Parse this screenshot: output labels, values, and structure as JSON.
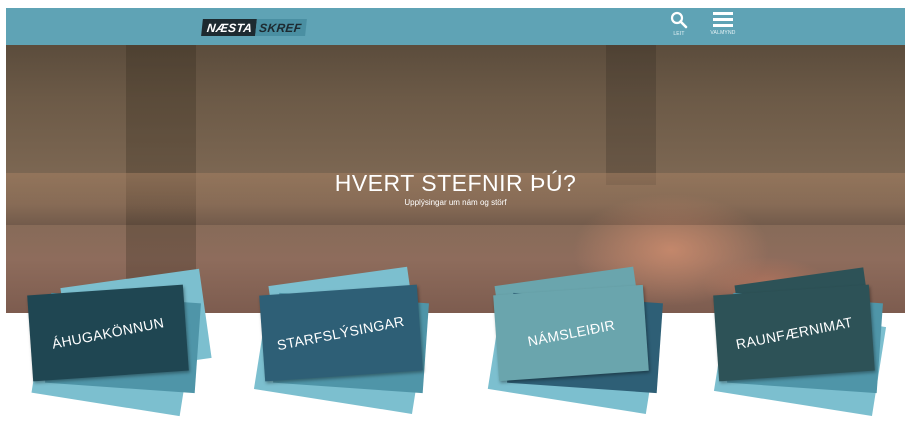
{
  "header": {
    "logo_part1": "NÆSTA",
    "logo_part2": "SKREF",
    "search_label": "LEIT",
    "menu_label": "VALMYND",
    "icons": [
      "search-icon",
      "hamburger-menu-icon"
    ],
    "bar_color": "#5fa3b5"
  },
  "hero": {
    "title": "HVERT STEFNIR ÞÚ?",
    "subtitle": "Upplýsingar um nám og störf"
  },
  "cards": [
    {
      "label": "ÁHUGAKÖNNUN",
      "color": "#1f4652"
    },
    {
      "label": "STARFSLÝSINGAR",
      "color": "#2e5f76"
    },
    {
      "label": "NÁMSLEIÐIR",
      "color": "#6aa5ad"
    },
    {
      "label": "RAUNFÆRNIMAT",
      "color": "#2d5257"
    }
  ],
  "colors": {
    "light_teal": "#7cbfcf",
    "mid_teal": "#4f95a8"
  }
}
